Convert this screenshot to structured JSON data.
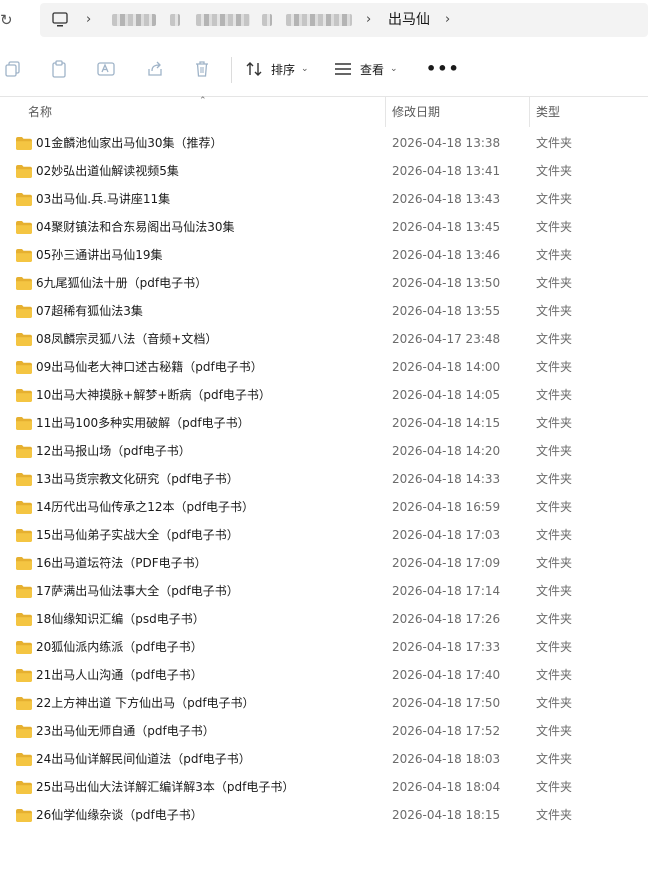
{
  "address_bar": {
    "current_folder": "出马仙",
    "separator": "›"
  },
  "toolbar": {
    "sort_label": "排序",
    "view_label": "查看",
    "more_label": "•••"
  },
  "columns": {
    "name": "名称",
    "modified": "修改日期",
    "type": "类型"
  },
  "files": [
    {
      "name": "01金麟池仙家出马仙30集（推荐）",
      "modified": "2026-04-18 13:38",
      "type": "文件夹"
    },
    {
      "name": "02妙弘出道仙解读视频5集",
      "modified": "2026-04-18 13:41",
      "type": "文件夹"
    },
    {
      "name": "03出马仙.兵.马讲座11集",
      "modified": "2026-04-18 13:43",
      "type": "文件夹"
    },
    {
      "name": "04聚财镇法和合东易阁出马仙法30集",
      "modified": "2026-04-18 13:45",
      "type": "文件夹"
    },
    {
      "name": "05孙三通讲出马仙19集",
      "modified": "2026-04-18 13:46",
      "type": "文件夹"
    },
    {
      "name": "6九尾狐仙法十册（pdf电子书）",
      "modified": "2026-04-18 13:50",
      "type": "文件夹"
    },
    {
      "name": "07超稀有狐仙法3集",
      "modified": "2026-04-18 13:55",
      "type": "文件夹"
    },
    {
      "name": "08凤麟宗灵狐八法（音频+文档）",
      "modified": "2026-04-17 23:48",
      "type": "文件夹"
    },
    {
      "name": "09出马仙老大神口述古秘籍（pdf电子书）",
      "modified": "2026-04-18 14:00",
      "type": "文件夹"
    },
    {
      "name": "10出马大神摸脉+解梦+断病（pdf电子书）",
      "modified": "2026-04-18 14:05",
      "type": "文件夹"
    },
    {
      "name": "11出马100多种实用破解（pdf电子书）",
      "modified": "2026-04-18 14:15",
      "type": "文件夹"
    },
    {
      "name": "12出马报山场（pdf电子书）",
      "modified": "2026-04-18 14:20",
      "type": "文件夹"
    },
    {
      "name": "13出马货宗教文化研究（pdf电子书）",
      "modified": "2026-04-18 14:33",
      "type": "文件夹"
    },
    {
      "name": "14历代出马仙传承之12本（pdf电子书）",
      "modified": "2026-04-18 16:59",
      "type": "文件夹"
    },
    {
      "name": "15出马仙弟子实战大全（pdf电子书）",
      "modified": "2026-04-18 17:03",
      "type": "文件夹"
    },
    {
      "name": "16出马道坛符法（PDF电子书）",
      "modified": "2026-04-18 17:09",
      "type": "文件夹"
    },
    {
      "name": "17萨满出马仙法事大全（pdf电子书）",
      "modified": "2026-04-18 17:14",
      "type": "文件夹"
    },
    {
      "name": "18仙缘知识汇编（psd电子书）",
      "modified": "2026-04-18 17:26",
      "type": "文件夹"
    },
    {
      "name": "20狐仙派内练派（pdf电子书）",
      "modified": "2026-04-18 17:33",
      "type": "文件夹"
    },
    {
      "name": "21出马人山沟通（pdf电子书）",
      "modified": "2026-04-18 17:40",
      "type": "文件夹"
    },
    {
      "name": "22上方神出道 下方仙出马（pdf电子书）",
      "modified": "2026-04-18 17:50",
      "type": "文件夹"
    },
    {
      "name": "23出马仙无师自通（pdf电子书）",
      "modified": "2026-04-18 17:52",
      "type": "文件夹"
    },
    {
      "name": "24出马仙详解民间仙道法（pdf电子书）",
      "modified": "2026-04-18 18:03",
      "type": "文件夹"
    },
    {
      "name": "25出马出仙大法详解汇编详解3本（pdf电子书）",
      "modified": "2026-04-18 18:04",
      "type": "文件夹"
    },
    {
      "name": "26仙学仙缘杂谈（pdf电子书）",
      "modified": "2026-04-18 18:15",
      "type": "文件夹"
    }
  ],
  "colors": {
    "folder": "#f4c542",
    "folder_tab": "#e6b030",
    "header_text": "#5a5a5a",
    "meta_text": "#6b6b6b",
    "icon_disabled": "#9fb3c8"
  }
}
